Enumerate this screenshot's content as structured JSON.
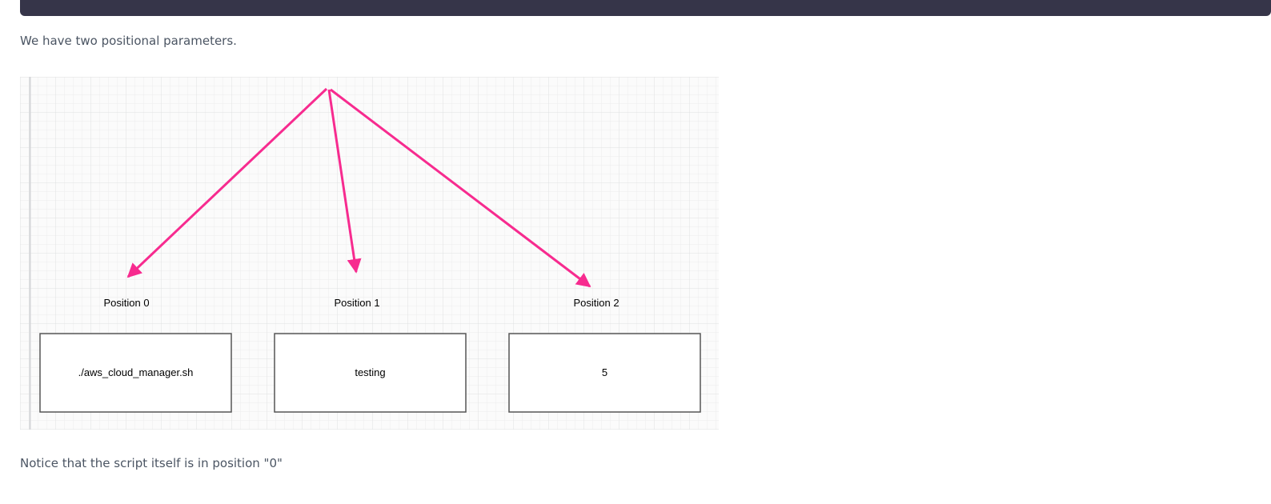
{
  "content": {
    "intro_text": "We have two positional parameters.",
    "note_text": "Notice that the script itself is in position \"0\""
  },
  "diagram": {
    "arrow_color": "#f72b8f",
    "positions": [
      {
        "label": "Position 0",
        "value": "./aws_cloud_manager.sh"
      },
      {
        "label": "Position 1",
        "value": "testing"
      },
      {
        "label": "Position 2",
        "value": "5"
      }
    ]
  }
}
